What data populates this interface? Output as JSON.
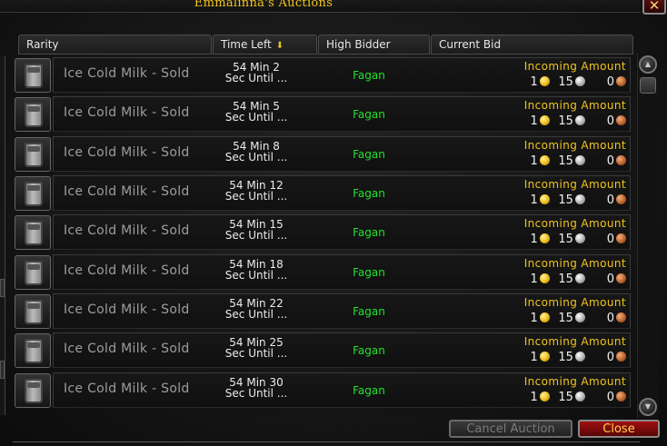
{
  "window": {
    "title": "Emmalinna's Auctions",
    "close_glyph": "✕"
  },
  "columns": {
    "rarity": "Rarity",
    "time_left": "Time Left",
    "high_bidder": "High Bidder",
    "current_bid": "Current Bid"
  },
  "rows": [
    {
      "name": "Ice Cold Milk - Sold",
      "time_line1": "54 Min 2",
      "time_line2": "Sec Until ...",
      "bidder": "Fagan",
      "bid_label": "Incoming Amount",
      "gold": "1",
      "silver": "15",
      "copper": "0"
    },
    {
      "name": "Ice Cold Milk - Sold",
      "time_line1": "54 Min 5",
      "time_line2": "Sec Until ...",
      "bidder": "Fagan",
      "bid_label": "Incoming Amount",
      "gold": "1",
      "silver": "15",
      "copper": "0"
    },
    {
      "name": "Ice Cold Milk - Sold",
      "time_line1": "54 Min 8",
      "time_line2": "Sec Until ...",
      "bidder": "Fagan",
      "bid_label": "Incoming Amount",
      "gold": "1",
      "silver": "15",
      "copper": "0"
    },
    {
      "name": "Ice Cold Milk - Sold",
      "time_line1": "54 Min 12",
      "time_line2": "Sec Until ...",
      "bidder": "Fagan",
      "bid_label": "Incoming Amount",
      "gold": "1",
      "silver": "15",
      "copper": "0"
    },
    {
      "name": "Ice Cold Milk - Sold",
      "time_line1": "54 Min 15",
      "time_line2": "Sec Until ...",
      "bidder": "Fagan",
      "bid_label": "Incoming Amount",
      "gold": "1",
      "silver": "15",
      "copper": "0"
    },
    {
      "name": "Ice Cold Milk - Sold",
      "time_line1": "54 Min 18",
      "time_line2": "Sec Until ...",
      "bidder": "Fagan",
      "bid_label": "Incoming Amount",
      "gold": "1",
      "silver": "15",
      "copper": "0"
    },
    {
      "name": "Ice Cold Milk - Sold",
      "time_line1": "54 Min 22",
      "time_line2": "Sec Until ...",
      "bidder": "Fagan",
      "bid_label": "Incoming Amount",
      "gold": "1",
      "silver": "15",
      "copper": "0"
    },
    {
      "name": "Ice Cold Milk - Sold",
      "time_line1": "54 Min 25",
      "time_line2": "Sec Until ...",
      "bidder": "Fagan",
      "bid_label": "Incoming Amount",
      "gold": "1",
      "silver": "15",
      "copper": "0"
    },
    {
      "name": "Ice Cold Milk - Sold",
      "time_line1": "54 Min 30",
      "time_line2": "Sec Until ...",
      "bidder": "Fagan",
      "bid_label": "Incoming Amount",
      "gold": "1",
      "silver": "15",
      "copper": "0"
    }
  ],
  "buttons": {
    "cancel_auction": "Cancel Auction",
    "close": "Close"
  },
  "icons": {
    "item": "milk-glass-icon",
    "sort": "sort-arrow-icon",
    "scroll_up": "scroll-up-icon",
    "scroll_down": "scroll-down-icon"
  },
  "colors": {
    "title": "#f2c51c",
    "item_poor_quality": "#9d9d9d",
    "bidder": "#22e22e",
    "bid_label": "#f2c51c",
    "close_button": "#a01010"
  }
}
